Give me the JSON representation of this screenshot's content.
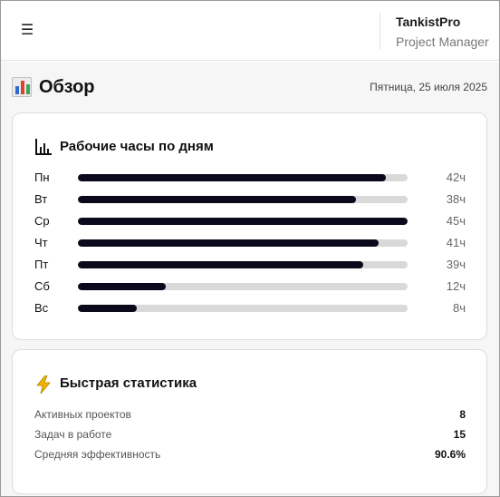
{
  "header": {
    "menu_icon": "☰",
    "brand_name": "TankistPro",
    "brand_subtitle": "Project Manager"
  },
  "page": {
    "title_icon": "bar-chart-icon",
    "title": "Обзор",
    "date": "Пятница, 25 июля 2025"
  },
  "work_hours": {
    "title_icon": "bar-chart-outline-icon",
    "title": "Рабочие часы по дням",
    "max_hours": 45,
    "bar_color": "#0a0a1c",
    "track_color": "#d9d9d9",
    "days": [
      {
        "day": "Пн",
        "hours": 42,
        "label": "42ч"
      },
      {
        "day": "Вт",
        "hours": 38,
        "label": "38ч"
      },
      {
        "day": "Ср",
        "hours": 45,
        "label": "45ч"
      },
      {
        "day": "Чт",
        "hours": 41,
        "label": "41ч"
      },
      {
        "day": "Пт",
        "hours": 39,
        "label": "39ч"
      },
      {
        "day": "Сб",
        "hours": 12,
        "label": "12ч"
      },
      {
        "day": "Вс",
        "hours": 8,
        "label": "8ч"
      }
    ]
  },
  "quick_stats": {
    "title_icon": "lightning-icon",
    "title": "Быстрая статистика",
    "items": [
      {
        "label": "Активных проектов",
        "value": "8"
      },
      {
        "label": "Задач в работе",
        "value": "15"
      },
      {
        "label": "Средняя эффективность",
        "value": "90.6%"
      }
    ]
  }
}
